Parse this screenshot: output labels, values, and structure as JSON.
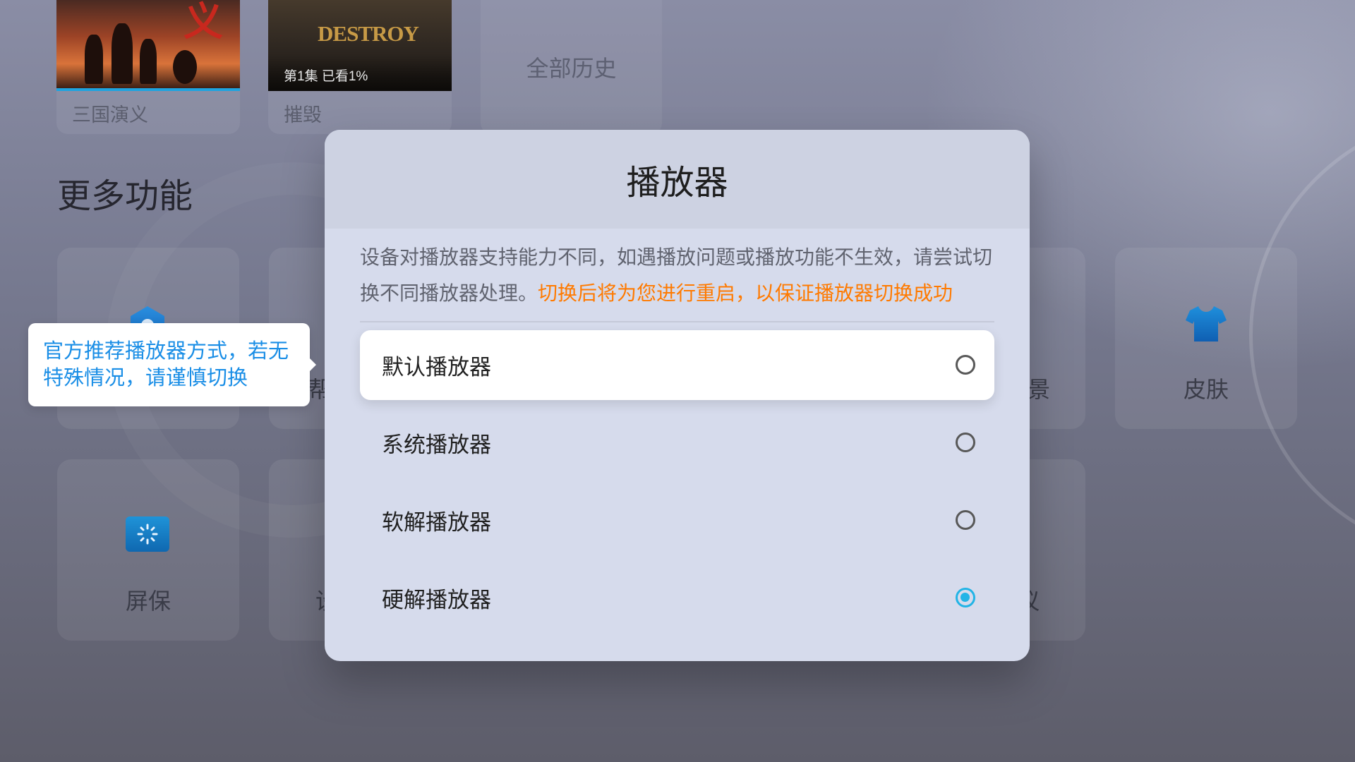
{
  "history": {
    "items": [
      {
        "title": "三国演义",
        "art_text": "义",
        "progress": 1
      },
      {
        "title": "摧毁",
        "art_text": "DESTROY",
        "badge": "第1集 已看1%"
      }
    ],
    "all_history_label": "全部历史"
  },
  "more_functions": {
    "heading": "更多功能",
    "tiles": {
      "r1c1": {
        "icon": "hexagon-icon"
      },
      "r1c2": {
        "label_fragment": "帮"
      },
      "r1c3": {
        "label_fragment": "景"
      },
      "skin": {
        "label": "皮肤",
        "icon": "tshirt-icon"
      },
      "screensaver": {
        "label": "屏保",
        "icon": "screensaver-icon"
      },
      "r2c2": {
        "label_fragment": "设"
      },
      "r2c3": {
        "label_fragment": "议"
      }
    }
  },
  "tooltip": {
    "text": "官方推荐播放器方式，若无特殊情况，请谨慎切换"
  },
  "player_dialog": {
    "title": "播放器",
    "description": "设备对播放器支持能力不同，如遇播放问题或播放功能不生效，请尝试切换不同播放器处理。",
    "description_highlight": "切换后将为您进行重启，以保证播放器切换成功",
    "options": [
      {
        "label": "默认播放器",
        "selected": false,
        "focused": true
      },
      {
        "label": "系统播放器",
        "selected": false,
        "focused": false
      },
      {
        "label": "软解播放器",
        "selected": false,
        "focused": false
      },
      {
        "label": "硬解播放器",
        "selected": true,
        "focused": false
      }
    ]
  },
  "colors": {
    "accent": "#22b4e6",
    "highlight": "#ff7a00",
    "tooltip_text": "#1a8ee6",
    "progress": "#1ea4e0"
  }
}
